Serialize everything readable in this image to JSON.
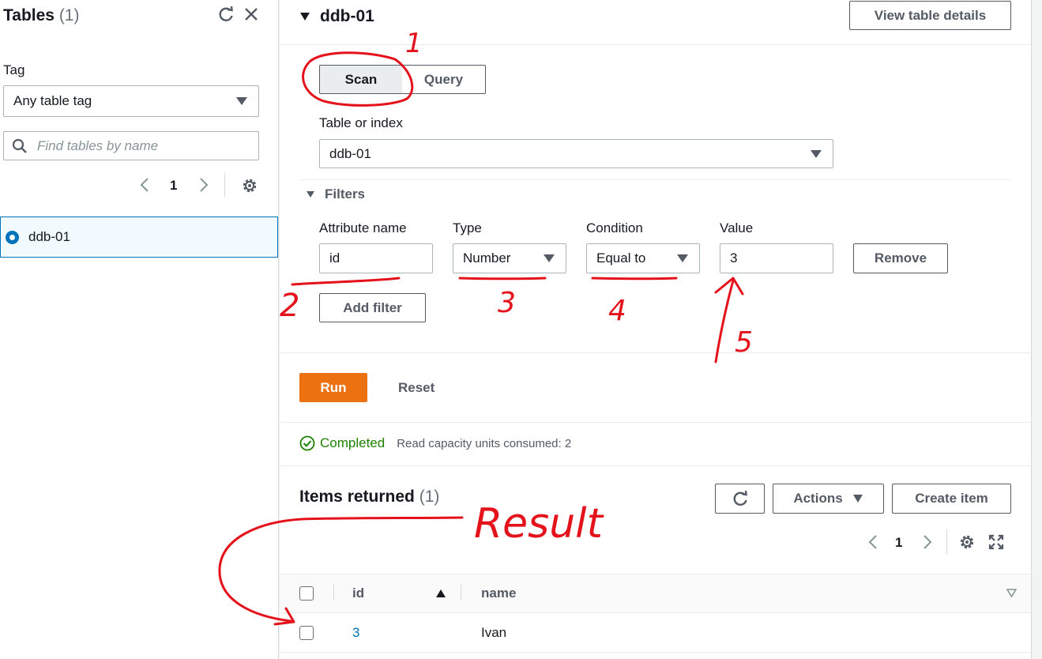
{
  "sidebar": {
    "title": "Tables",
    "count": "(1)",
    "tag_label": "Tag",
    "tag_select": "Any table tag",
    "search_placeholder": "Find tables by name",
    "page": "1",
    "tables": [
      {
        "name": "ddb-01",
        "selected": true
      }
    ]
  },
  "header": {
    "table_name": "ddb-01",
    "view_details": "View table details"
  },
  "mode": {
    "scan": "Scan",
    "query": "Query",
    "active": "scan"
  },
  "table_or_index": {
    "label": "Table or index",
    "value": "ddb-01"
  },
  "filters": {
    "title": "Filters",
    "columns": {
      "attribute": "Attribute name",
      "type": "Type",
      "condition": "Condition",
      "value": "Value"
    },
    "row": {
      "attribute": "id",
      "type": "Number",
      "condition": "Equal to",
      "value": "3"
    },
    "remove": "Remove",
    "add": "Add filter"
  },
  "actions": {
    "run": "Run",
    "reset": "Reset"
  },
  "status": {
    "text": "Completed",
    "detail": "Read capacity units consumed: 2"
  },
  "results": {
    "title": "Items returned",
    "count": "(1)",
    "actions_btn": "Actions",
    "create_btn": "Create item",
    "page": "1",
    "columns": [
      "id",
      "name"
    ],
    "rows": [
      {
        "id": "3",
        "name": "Ivan"
      }
    ]
  },
  "annotations": {
    "n1": "1",
    "n2": "2",
    "n3": "3",
    "n4": "4",
    "n5": "5",
    "result": "Result",
    "color": "#e4121b"
  },
  "colors": {
    "primary": "#ec7211",
    "link": "#0073bb",
    "success": "#1d8102"
  }
}
